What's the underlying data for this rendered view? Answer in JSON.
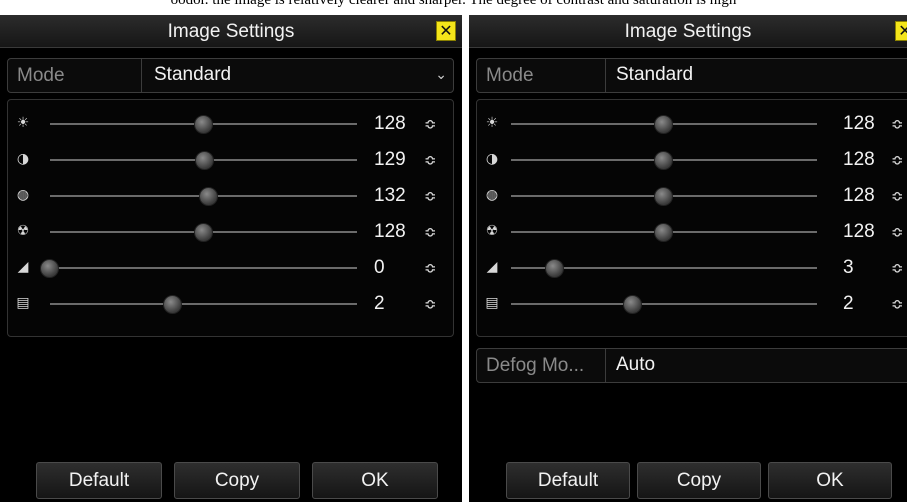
{
  "caption": "oodor. the image is relatively clearer and sharper. The degree of contrast and saturation is high",
  "dialogs": {
    "left": {
      "title": "Image Settings",
      "mode": {
        "label": "Mode",
        "value": "Standard"
      },
      "sliders": [
        {
          "icon": "brightness-icon",
          "value": "128",
          "level": 0.5
        },
        {
          "icon": "contrast-icon",
          "value": "129",
          "level": 0.506
        },
        {
          "icon": "saturation-icon",
          "value": "132",
          "level": 0.518
        },
        {
          "icon": "hue-icon",
          "value": "128",
          "level": 0.5
        },
        {
          "icon": "sharpness-icon",
          "value": "0",
          "level": 0.0
        },
        {
          "icon": "denoise-icon",
          "value": "2",
          "level": 0.4
        }
      ],
      "buttons": {
        "default": "Default",
        "copy": "Copy",
        "ok": "OK"
      }
    },
    "right": {
      "title": "Image Settings",
      "mode": {
        "label": "Mode",
        "value": "Standard"
      },
      "sliders": [
        {
          "icon": "brightness-icon",
          "value": "128",
          "level": 0.5
        },
        {
          "icon": "contrast-icon",
          "value": "128",
          "level": 0.5
        },
        {
          "icon": "saturation-icon",
          "value": "128",
          "level": 0.5
        },
        {
          "icon": "hue-icon",
          "value": "128",
          "level": 0.5
        },
        {
          "icon": "sharpness-icon",
          "value": "3",
          "level": 0.145
        },
        {
          "icon": "denoise-icon",
          "value": "2",
          "level": 0.4
        }
      ],
      "defog": {
        "label": "Defog Mo...",
        "value": "Auto"
      },
      "buttons": {
        "default": "Default",
        "copy": "Copy",
        "ok": "OK"
      }
    }
  },
  "icons": {
    "close": "✕",
    "chevron": "⌄",
    "spin": "⌃⌄"
  }
}
